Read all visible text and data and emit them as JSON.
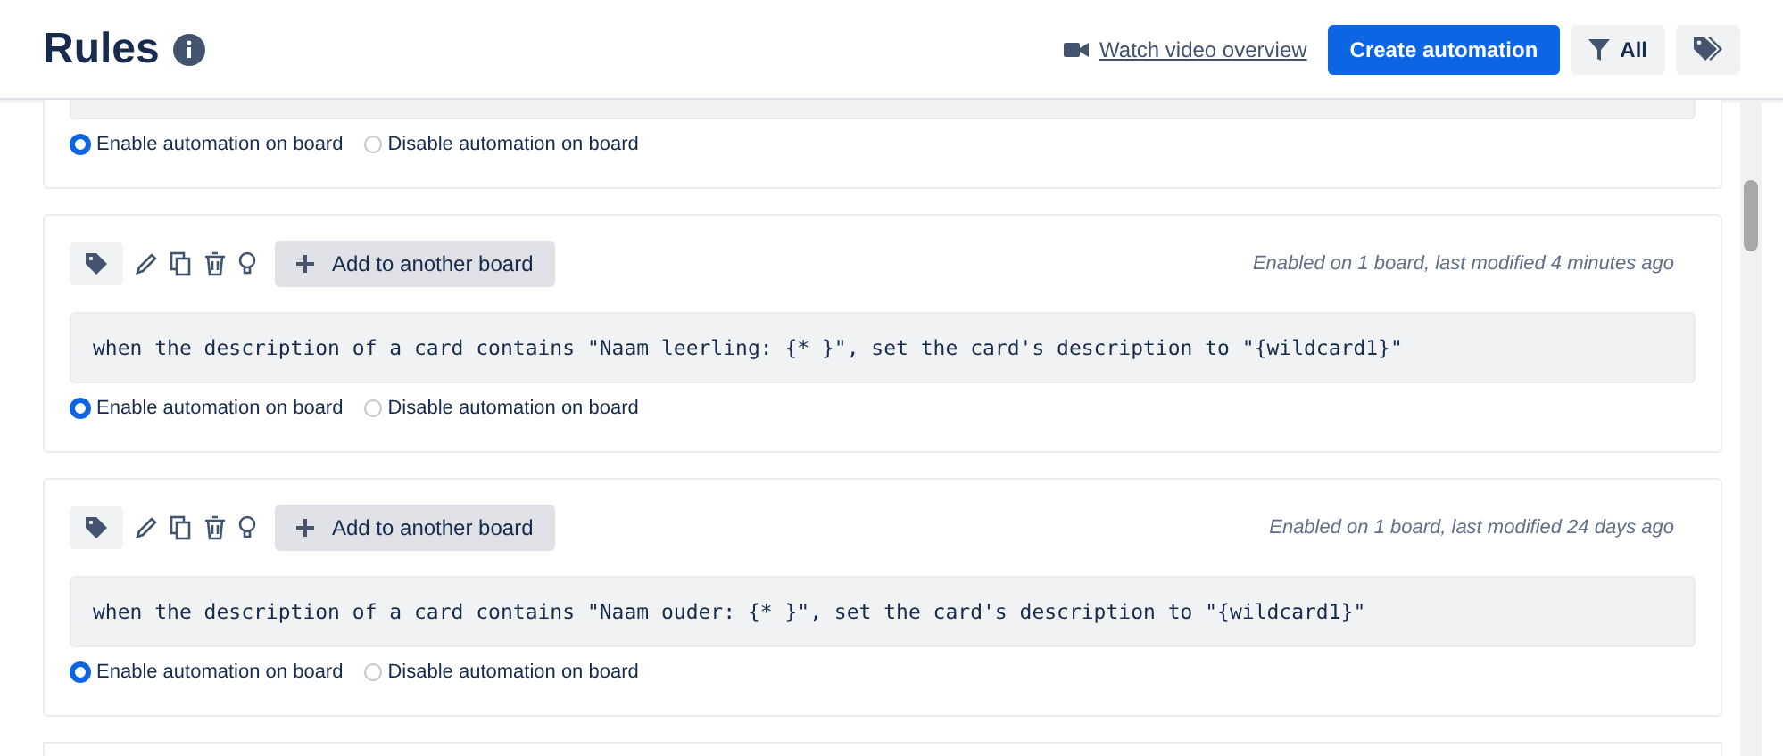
{
  "header": {
    "title": "Rules",
    "video_link": "Watch video overview",
    "create_button": "Create automation",
    "filter_button": "All"
  },
  "rules": [
    {
      "options": [
        {
          "label": "Enable automation on board",
          "selected": true
        },
        {
          "label": "Disable automation on board",
          "selected": false
        }
      ]
    },
    {
      "add_button": "Add to another board",
      "meta": "Enabled on 1 board, last modified 4 minutes ago",
      "description": "when the description of a card contains \"Naam leerling: {* }\", set the card's description to \"{wildcard1}\"",
      "options": [
        {
          "label": "Enable automation on board",
          "selected": true
        },
        {
          "label": "Disable automation on board",
          "selected": false
        }
      ]
    },
    {
      "add_button": "Add to another board",
      "meta": "Enabled on 1 board, last modified 24 days ago",
      "description": "when the description of a card contains \"Naam ouder: {* }\", set the card's description to \"{wildcard1}\"",
      "options": [
        {
          "label": "Enable automation on board",
          "selected": true
        },
        {
          "label": "Disable automation on board",
          "selected": false
        }
      ]
    }
  ]
}
